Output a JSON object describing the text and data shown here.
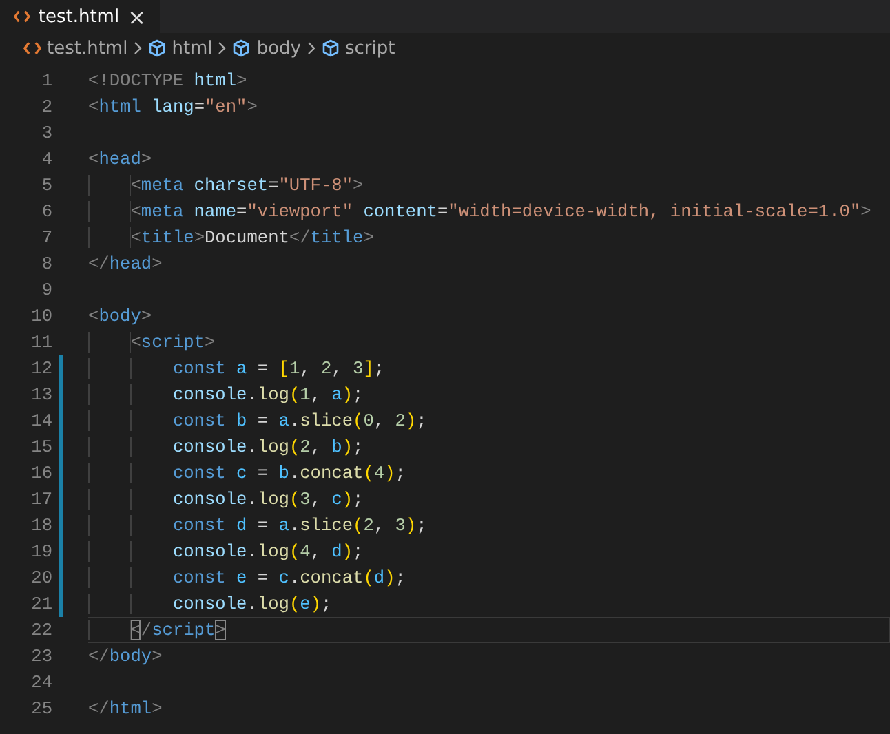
{
  "tabs": [
    {
      "label": "test.html",
      "selected": true,
      "close": "×"
    }
  ],
  "breadcrumbs": [
    {
      "label": "test.html",
      "kind": "file"
    },
    {
      "label": "html",
      "kind": "element"
    },
    {
      "label": "body",
      "kind": "element"
    },
    {
      "label": "script",
      "kind": "element"
    }
  ],
  "lines": [
    {
      "number": "1",
      "modified": false,
      "current": false,
      "tokens": [
        {
          "kind": "punct",
          "text": "<!DOCTYPE"
        },
        {
          "kind": "attr",
          "text": " html"
        },
        {
          "kind": "punct",
          "text": ">"
        }
      ]
    },
    {
      "number": "2",
      "modified": false,
      "current": false,
      "tokens": [
        {
          "kind": "punct",
          "text": "<"
        },
        {
          "kind": "tag",
          "text": "html"
        },
        {
          "kind": "attr",
          "text": " lang"
        },
        {
          "kind": "text",
          "text": "="
        },
        {
          "kind": "string",
          "text": "\"en\""
        },
        {
          "kind": "punct",
          "text": ">"
        }
      ]
    },
    {
      "number": "3",
      "modified": false,
      "current": false
    },
    {
      "number": "4",
      "modified": false,
      "current": false,
      "tokens": [
        {
          "kind": "punct",
          "text": "<"
        },
        {
          "kind": "tag",
          "text": "head"
        },
        {
          "kind": "punct",
          "text": ">"
        }
      ]
    },
    {
      "number": "5",
      "modified": false,
      "current": false,
      "tokens": [
        {
          "kind": "punct",
          "text": "    <"
        },
        {
          "kind": "tag",
          "text": "meta"
        },
        {
          "kind": "attr",
          "text": " charset"
        },
        {
          "kind": "text",
          "text": "="
        },
        {
          "kind": "string",
          "text": "\"UTF-8\""
        },
        {
          "kind": "punct",
          "text": ">"
        }
      ]
    },
    {
      "number": "6",
      "modified": false,
      "current": false,
      "tokens": [
        {
          "kind": "punct",
          "text": "    <"
        },
        {
          "kind": "tag",
          "text": "meta"
        },
        {
          "kind": "attr",
          "text": " name"
        },
        {
          "kind": "text",
          "text": "="
        },
        {
          "kind": "string",
          "text": "\"viewport\""
        },
        {
          "kind": "attr",
          "text": " content"
        },
        {
          "kind": "text",
          "text": "="
        },
        {
          "kind": "string",
          "text": "\"width=device-width, initial-scale=1.0\""
        },
        {
          "kind": "punct",
          "text": ">"
        }
      ]
    },
    {
      "number": "7",
      "modified": false,
      "current": false,
      "tokens": [
        {
          "kind": "punct",
          "text": "    <"
        },
        {
          "kind": "tag",
          "text": "title"
        },
        {
          "kind": "punct",
          "text": ">"
        },
        {
          "kind": "text",
          "text": "Document"
        },
        {
          "kind": "punct",
          "text": "</"
        },
        {
          "kind": "tag",
          "text": "title"
        },
        {
          "kind": "punct",
          "text": ">"
        }
      ]
    },
    {
      "number": "8",
      "modified": false,
      "current": false,
      "tokens": [
        {
          "kind": "punct",
          "text": "</"
        },
        {
          "kind": "tag",
          "text": "head"
        },
        {
          "kind": "punct",
          "text": ">"
        }
      ]
    },
    {
      "number": "9",
      "modified": false,
      "current": false
    },
    {
      "number": "10",
      "modified": false,
      "current": false,
      "tokens": [
        {
          "kind": "punct",
          "text": "<"
        },
        {
          "kind": "tag",
          "text": "body"
        },
        {
          "kind": "punct",
          "text": ">"
        }
      ]
    },
    {
      "number": "11",
      "modified": false,
      "current": false,
      "tokens": [
        {
          "kind": "punct",
          "text": "    <"
        },
        {
          "kind": "tag",
          "text": "script"
        },
        {
          "kind": "punct",
          "text": ">"
        }
      ]
    },
    {
      "number": "12",
      "modified": true,
      "current": false,
      "tokens": [
        {
          "kind": "keyword",
          "text": "        const"
        },
        {
          "kind": "variable",
          "text": " a"
        },
        {
          "kind": "text",
          "text": " = "
        },
        {
          "kind": "bracket",
          "text": "["
        },
        {
          "kind": "number",
          "text": "1"
        },
        {
          "kind": "text",
          "text": ", "
        },
        {
          "kind": "number",
          "text": "2"
        },
        {
          "kind": "text",
          "text": ", "
        },
        {
          "kind": "number",
          "text": "3"
        },
        {
          "kind": "bracket",
          "text": "]"
        },
        {
          "kind": "text",
          "text": ";"
        }
      ]
    },
    {
      "number": "13",
      "modified": true,
      "current": false,
      "tokens": [
        {
          "kind": "object",
          "text": "        console"
        },
        {
          "kind": "text",
          "text": "."
        },
        {
          "kind": "function",
          "text": "log"
        },
        {
          "kind": "bracket",
          "text": "("
        },
        {
          "kind": "number",
          "text": "1"
        },
        {
          "kind": "text",
          "text": ","
        },
        {
          "kind": "variable",
          "text": " a"
        },
        {
          "kind": "bracket",
          "text": ")"
        },
        {
          "kind": "text",
          "text": ";"
        }
      ]
    },
    {
      "number": "14",
      "modified": true,
      "current": false,
      "tokens": [
        {
          "kind": "keyword",
          "text": "        const"
        },
        {
          "kind": "variable",
          "text": " b"
        },
        {
          "kind": "text",
          "text": " = "
        },
        {
          "kind": "variable",
          "text": "a"
        },
        {
          "kind": "text",
          "text": "."
        },
        {
          "kind": "function",
          "text": "slice"
        },
        {
          "kind": "bracket",
          "text": "("
        },
        {
          "kind": "number",
          "text": "0"
        },
        {
          "kind": "text",
          "text": ","
        },
        {
          "kind": "number",
          "text": " 2"
        },
        {
          "kind": "bracket",
          "text": ")"
        },
        {
          "kind": "text",
          "text": ";"
        }
      ]
    },
    {
      "number": "15",
      "modified": true,
      "current": false,
      "tokens": [
        {
          "kind": "object",
          "text": "        console"
        },
        {
          "kind": "text",
          "text": "."
        },
        {
          "kind": "function",
          "text": "log"
        },
        {
          "kind": "bracket",
          "text": "("
        },
        {
          "kind": "number",
          "text": "2"
        },
        {
          "kind": "text",
          "text": ","
        },
        {
          "kind": "variable",
          "text": " b"
        },
        {
          "kind": "bracket",
          "text": ")"
        },
        {
          "kind": "text",
          "text": ";"
        }
      ]
    },
    {
      "number": "16",
      "modified": true,
      "current": false,
      "tokens": [
        {
          "kind": "keyword",
          "text": "        const"
        },
        {
          "kind": "variable",
          "text": " c"
        },
        {
          "kind": "text",
          "text": " = "
        },
        {
          "kind": "variable",
          "text": "b"
        },
        {
          "kind": "text",
          "text": "."
        },
        {
          "kind": "function",
          "text": "concat"
        },
        {
          "kind": "bracket",
          "text": "("
        },
        {
          "kind": "number",
          "text": "4"
        },
        {
          "kind": "bracket",
          "text": ")"
        },
        {
          "kind": "text",
          "text": ";"
        }
      ]
    },
    {
      "number": "17",
      "modified": true,
      "current": false,
      "tokens": [
        {
          "kind": "object",
          "text": "        console"
        },
        {
          "kind": "text",
          "text": "."
        },
        {
          "kind": "function",
          "text": "log"
        },
        {
          "kind": "bracket",
          "text": "("
        },
        {
          "kind": "number",
          "text": "3"
        },
        {
          "kind": "text",
          "text": ","
        },
        {
          "kind": "variable",
          "text": " c"
        },
        {
          "kind": "bracket",
          "text": ")"
        },
        {
          "kind": "text",
          "text": ";"
        }
      ]
    },
    {
      "number": "18",
      "modified": true,
      "current": false,
      "tokens": [
        {
          "kind": "keyword",
          "text": "        const"
        },
        {
          "kind": "variable",
          "text": " d"
        },
        {
          "kind": "text",
          "text": " = "
        },
        {
          "kind": "variable",
          "text": "a"
        },
        {
          "kind": "text",
          "text": "."
        },
        {
          "kind": "function",
          "text": "slice"
        },
        {
          "kind": "bracket",
          "text": "("
        },
        {
          "kind": "number",
          "text": "2"
        },
        {
          "kind": "text",
          "text": ","
        },
        {
          "kind": "number",
          "text": " 3"
        },
        {
          "kind": "bracket",
          "text": ")"
        },
        {
          "kind": "text",
          "text": ";"
        }
      ]
    },
    {
      "number": "19",
      "modified": true,
      "current": false,
      "tokens": [
        {
          "kind": "object",
          "text": "        console"
        },
        {
          "kind": "text",
          "text": "."
        },
        {
          "kind": "function",
          "text": "log"
        },
        {
          "kind": "bracket",
          "text": "("
        },
        {
          "kind": "number",
          "text": "4"
        },
        {
          "kind": "text",
          "text": ","
        },
        {
          "kind": "variable",
          "text": " d"
        },
        {
          "kind": "bracket",
          "text": ")"
        },
        {
          "kind": "text",
          "text": ";"
        }
      ]
    },
    {
      "number": "20",
      "modified": true,
      "current": false,
      "tokens": [
        {
          "kind": "keyword",
          "text": "        const"
        },
        {
          "kind": "variable",
          "text": " e"
        },
        {
          "kind": "text",
          "text": " = "
        },
        {
          "kind": "variable",
          "text": "c"
        },
        {
          "kind": "text",
          "text": "."
        },
        {
          "kind": "function",
          "text": "concat"
        },
        {
          "kind": "bracket",
          "text": "("
        },
        {
          "kind": "variable",
          "text": "d"
        },
        {
          "kind": "bracket",
          "text": ")"
        },
        {
          "kind": "text",
          "text": ";"
        }
      ]
    },
    {
      "number": "21",
      "modified": true,
      "current": false,
      "tokens": [
        {
          "kind": "object",
          "text": "        console"
        },
        {
          "kind": "text",
          "text": "."
        },
        {
          "kind": "function",
          "text": "log"
        },
        {
          "kind": "bracket",
          "text": "("
        },
        {
          "kind": "variable",
          "text": "e"
        },
        {
          "kind": "bracket",
          "text": ")"
        },
        {
          "kind": "text",
          "text": ";"
        }
      ]
    },
    {
      "number": "22",
      "modified": false,
      "current": true,
      "tokens": [
        {
          "kind": "match",
          "text": "    <"
        },
        {
          "kind": "punct",
          "text": "/"
        },
        {
          "kind": "tag",
          "text": "script"
        },
        {
          "kind": "match",
          "text": ">"
        }
      ]
    },
    {
      "number": "23",
      "modified": false,
      "current": false,
      "tokens": [
        {
          "kind": "punct",
          "text": "</"
        },
        {
          "kind": "tag",
          "text": "body"
        },
        {
          "kind": "punct",
          "text": ">"
        }
      ]
    },
    {
      "number": "24",
      "modified": false,
      "current": false
    },
    {
      "number": "25",
      "modified": false,
      "current": false,
      "tokens": [
        {
          "kind": "punct",
          "text": "</"
        },
        {
          "kind": "tag",
          "text": "html"
        },
        {
          "kind": "punct",
          "text": ">"
        }
      ]
    }
  ]
}
